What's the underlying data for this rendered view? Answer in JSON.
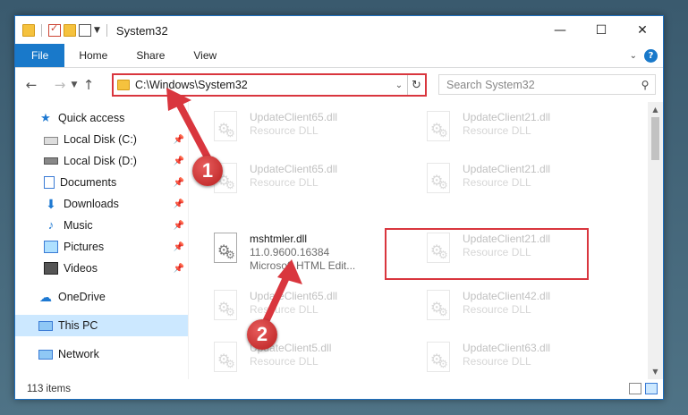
{
  "window": {
    "title": "System32",
    "controls": {
      "minimize": "—",
      "maximize": "☐",
      "close": "✕"
    }
  },
  "ribbon": {
    "tabs": [
      "File",
      "Home",
      "Share",
      "View"
    ],
    "help": "?"
  },
  "address_bar": {
    "path": "C:\\Windows\\System32"
  },
  "search": {
    "placeholder": "Search System32"
  },
  "sidebar": {
    "quick_access": "Quick access",
    "pinned": [
      "Local Disk (C:)",
      "Local Disk (D:)",
      "Documents",
      "Downloads",
      "Music",
      "Pictures",
      "Videos"
    ],
    "onedrive": "OneDrive",
    "this_pc": "This PC",
    "network": "Network"
  },
  "files": {
    "background": [
      {
        "name": "UpdateClient65.dll",
        "type": "Resource DLL"
      },
      {
        "name": "UpdateClient21.dll",
        "type": "Resource DLL"
      },
      {
        "name": "UpdateClient65.dll",
        "type": "Resource DLL"
      },
      {
        "name": "UpdateClient21.dll",
        "type": "Resource DLL"
      },
      {
        "name": "UpdateClient21.dll",
        "type": "Resource DLL"
      },
      {
        "name": "UpdateClient65.dll",
        "type": "Resource DLL"
      },
      {
        "name": "UpdateClient42.dll",
        "type": "Resource DLL"
      },
      {
        "name": "UpdateClient5.dll",
        "type": "Resource DLL"
      },
      {
        "name": "UpdateClient63.dll",
        "type": "Resource DLL"
      }
    ],
    "highlighted": {
      "name": "mshtmler.dll",
      "version": "11.0.9600.16384",
      "description": "Microsoft HTML Edit..."
    }
  },
  "status": {
    "item_count": "113 items"
  },
  "annotations": {
    "step1": "1",
    "step2": "2",
    "color": "#d9363e"
  }
}
